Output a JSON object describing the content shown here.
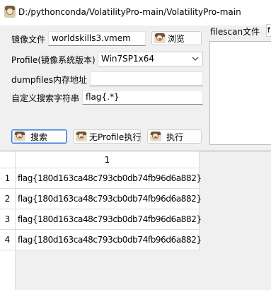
{
  "window": {
    "title": "D:/pythonconda/VolatilityPro-main/VolatilityPro-main"
  },
  "form": {
    "image_label": "镜像文件",
    "image_value": "worldskills3.vmem",
    "browse_label": "浏览",
    "profile_label": "Profile(镜像系统版本)",
    "profile_selected": "Win7SP1x64",
    "dumpfiles_label": "dumpfiles内存地址",
    "dumpfiles_value": "",
    "search_string_label": "自定义搜索字符串",
    "search_string_value": "flag{.*}",
    "filescan_label": "filescan文件",
    "filescan_value": "f"
  },
  "buttons": {
    "search": "搜索",
    "no_profile_run": "无Profile执行",
    "run": "执行"
  },
  "table": {
    "columns": [
      "1"
    ],
    "rows": [
      {
        "index": "1",
        "value": "flag{180d163ca48c793cb0db74fb96d6a882}"
      },
      {
        "index": "2",
        "value": "flag{180d163ca48c793cb0db74fb96d6a882}"
      },
      {
        "index": "3",
        "value": "flag{180d163ca48c793cb0db74fb96d6a882}"
      },
      {
        "index": "4",
        "value": "flag{180d163ca48c793cb0db74fb96d6a882}"
      }
    ]
  },
  "colors": {
    "primary_border": "#2a6fd6",
    "window_bg": "#f0f0f0"
  },
  "icons": {
    "app": "app-avatar-icon",
    "buttons": "avatar-icon"
  }
}
